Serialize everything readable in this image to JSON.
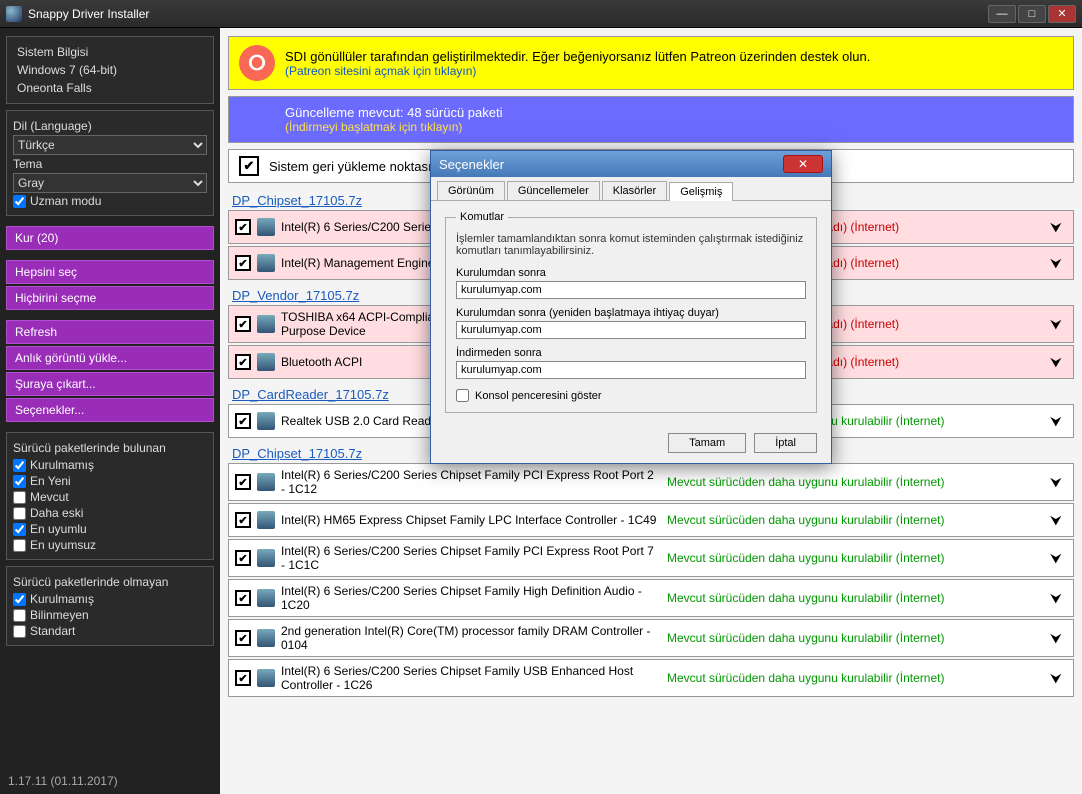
{
  "window": {
    "title": "Snappy Driver Installer"
  },
  "sidebar": {
    "sysinfo": {
      "heading": "Sistem Bilgisi",
      "os": "Windows 7 (64-bit)",
      "motherboard": "Oneonta Falls"
    },
    "lang_label": "Dil (Language)",
    "lang_value": "Türkçe",
    "theme_label": "Tema",
    "theme_value": "Gray",
    "expert_label": "Uzman modu",
    "actions": {
      "install": "Kur (20)",
      "select_all": "Hepsini seç",
      "select_none": "Hiçbirini seçme",
      "refresh": "Refresh",
      "load_snapshot": "Anlık görüntü yükle...",
      "extract_to": "Şuraya çıkart...",
      "options": "Seçenekler..."
    },
    "found": {
      "heading": "Sürücü paketlerinde bulunan",
      "not_installed": "Kurulmamış",
      "newest": "En Yeni",
      "current": "Mevcut",
      "older": "Daha eski",
      "most_compatible": "En uyumlu",
      "incompatible": "En uyumsuz"
    },
    "not_found": {
      "heading": "Sürücü paketlerinde olmayan",
      "not_installed": "Kurulmamış",
      "unknown": "Bilinmeyen",
      "standard": "Standart"
    },
    "version": "1.17.11 (01.11.2017)"
  },
  "banners": {
    "patreon_line1": "SDI gönüllüler tarafından geliştirilmektedir. Eğer beğeniyorsanız lütfen Patreon üzerinden destek olun.",
    "patreon_line2": "(Patreon sitesini açmak için tıklayın)",
    "update_line1": "Güncelleme mevcut: 48 sürücü paketi",
    "update_line2": "(İndirmeyi başlatmak için tıklayın)",
    "restore": "Sistem geri yükleme noktası oluştur"
  },
  "groups": [
    {
      "title": "DP_Chipset_17105.7z",
      "rows": [
        {
          "name": "Intel(R) 6 Series/C200 Series Chipset Family SMBus Controller - 1C22",
          "status": "Sürücü mevcut (henüz kurulmadı) (İnternet)",
          "color": "red",
          "bg": "pink"
        },
        {
          "name": "Intel(R) Management Engine Interface",
          "status": "Sürücü mevcut (henüz kurulmadı) (İnternet)",
          "color": "red",
          "bg": "pink"
        }
      ]
    },
    {
      "title": "DP_Vendor_17105.7z",
      "rows": [
        {
          "name": "TOSHIBA x64 ACPI-Compliant Value Added Logical and General Purpose Device",
          "status": "Sürücü mevcut (henüz kurulmadı) (İnternet)",
          "color": "red",
          "bg": "pink"
        },
        {
          "name": "Bluetooth ACPI",
          "status": "Sürücü mevcut (henüz kurulmadı) (İnternet)",
          "color": "red",
          "bg": "pink"
        }
      ]
    },
    {
      "title": "DP_CardReader_17105.7z",
      "rows": [
        {
          "name": "Realtek USB 2.0 Card Reader",
          "status": "Mevcut sürücüden daha uygunu kurulabilir (İnternet)",
          "color": "green",
          "bg": "white"
        }
      ]
    },
    {
      "title": "DP_Chipset_17105.7z",
      "rows": [
        {
          "name": "Intel(R) 6 Series/C200 Series Chipset Family PCI Express Root Port 2 - 1C12",
          "status": "Mevcut sürücüden daha uygunu kurulabilir (İnternet)",
          "color": "green",
          "bg": "white"
        },
        {
          "name": "Intel(R) HM65 Express Chipset Family LPC Interface Controller - 1C49",
          "status": "Mevcut sürücüden daha uygunu kurulabilir (İnternet)",
          "color": "green",
          "bg": "white"
        },
        {
          "name": "Intel(R) 6 Series/C200 Series Chipset Family PCI Express Root Port 7 - 1C1C",
          "status": "Mevcut sürücüden daha uygunu kurulabilir (İnternet)",
          "color": "green",
          "bg": "white"
        },
        {
          "name": "Intel(R) 6 Series/C200 Series Chipset Family High Definition Audio - 1C20",
          "status": "Mevcut sürücüden daha uygunu kurulabilir (İnternet)",
          "color": "green",
          "bg": "white"
        },
        {
          "name": "2nd generation Intel(R) Core(TM) processor family DRAM Controller - 0104",
          "status": "Mevcut sürücüden daha uygunu kurulabilir (İnternet)",
          "color": "green",
          "bg": "white"
        },
        {
          "name": "Intel(R) 6 Series/C200 Series Chipset Family USB Enhanced Host Controller - 1C26",
          "status": "Mevcut sürücüden daha uygunu kurulabilir (İnternet)",
          "color": "green",
          "bg": "white"
        }
      ]
    }
  ],
  "dialog": {
    "title": "Seçenekler",
    "tabs": {
      "view": "Görünüm",
      "updates": "Güncellemeler",
      "folders": "Klasörler",
      "advanced": "Gelişmiş"
    },
    "fieldset": "Komutlar",
    "desc": "İşlemler tamamlandıktan sonra komut isteminden çalıştırmak istediğiniz komutları tanımlayabilirsiniz.",
    "after_install_label": "Kurulumdan sonra",
    "after_install_value": "kurulumyap.com",
    "after_install_restart_label": "Kurulumdan sonra (yeniden başlatmaya ihtiyaç duyar)",
    "after_install_restart_value": "kurulumyap.com",
    "after_download_label": "İndirmeden sonra",
    "after_download_value": "kurulumyap.com",
    "show_console": "Konsol penceresini göster",
    "ok": "Tamam",
    "cancel": "İptal"
  }
}
